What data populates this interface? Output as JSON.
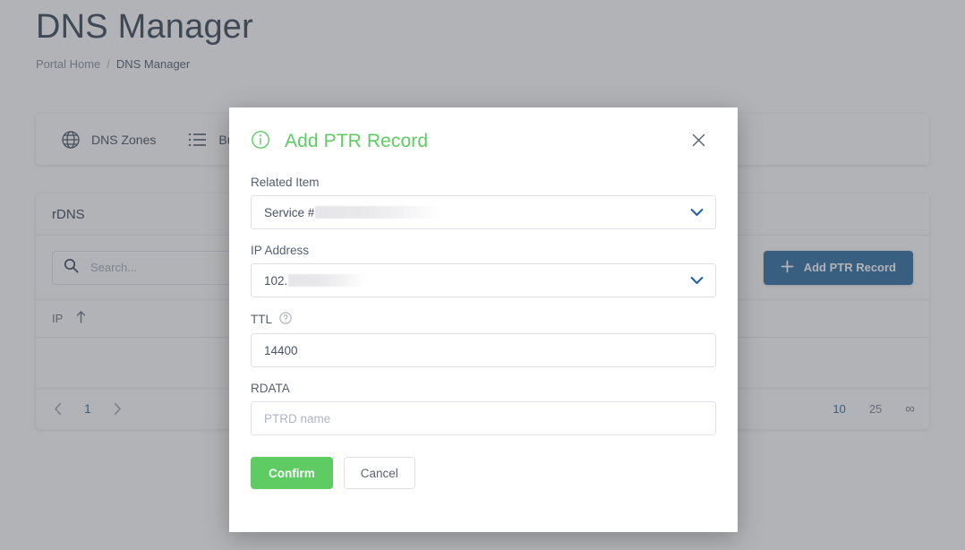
{
  "page": {
    "title": "DNS Manager",
    "breadcrumb": {
      "home": "Portal Home",
      "separator": "/",
      "current": "DNS Manager"
    }
  },
  "tabs": [
    {
      "label": "DNS Zones",
      "icon": "globe-icon"
    },
    {
      "label": "Bulk",
      "icon": "list-icon"
    }
  ],
  "rdns": {
    "heading": "rDNS",
    "search": {
      "placeholder": "Search...",
      "value": ""
    },
    "add_button": {
      "label": "Add PTR Record",
      "icon": "plus-icon",
      "color": "#2f6da3"
    },
    "columns": [
      {
        "label": "IP",
        "sort": "ascending"
      }
    ],
    "rows": [],
    "pagination": {
      "prev": "‹",
      "next": "›",
      "current_page": "1",
      "page_sizes": [
        "10",
        "25",
        "∞"
      ],
      "active_page_size": "10"
    }
  },
  "modal": {
    "title": "Add PTR Record",
    "info_icon": "info-circle-icon",
    "close_icon": "close-icon",
    "accent_color": "#5ecb63",
    "fields": {
      "related_item": {
        "label": "Related Item",
        "value": "Service #",
        "redacted": true,
        "icon": "chevron-down-icon"
      },
      "ip_address": {
        "label": "IP Address",
        "value": "102.",
        "redacted": true,
        "icon": "chevron-down-icon"
      },
      "ttl": {
        "label": "TTL",
        "help_icon": "help-circle-icon",
        "value": "14400"
      },
      "rdata": {
        "label": "RDATA",
        "value": "",
        "placeholder": "PTRD name"
      }
    },
    "buttons": {
      "confirm": "Confirm",
      "cancel": "Cancel"
    }
  }
}
